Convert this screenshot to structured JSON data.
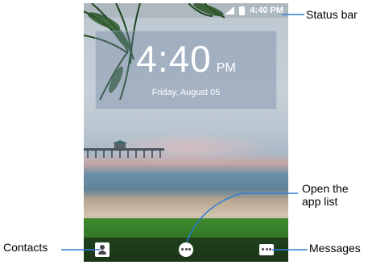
{
  "status_bar": {
    "time": "4:40 PM",
    "icons": [
      "signal-icon",
      "battery-icon"
    ]
  },
  "lock_clock": {
    "time": "4:40",
    "ampm": "PM",
    "date": "Friday, August 05"
  },
  "dock": {
    "items": [
      {
        "name": "contacts",
        "icon": "contacts-icon"
      },
      {
        "name": "app-list",
        "icon": "app-list-icon"
      },
      {
        "name": "messages",
        "icon": "messages-icon"
      }
    ]
  },
  "callouts": {
    "status_bar": "Status bar",
    "open_app_list": "Open the app list",
    "contacts": "Contacts",
    "messages": "Messages"
  },
  "colors": {
    "leader": "#2a7fd4"
  }
}
